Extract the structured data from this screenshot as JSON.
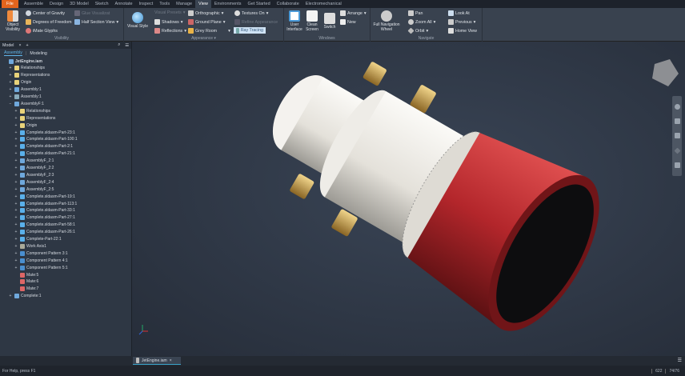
{
  "ribbon_tabs": [
    {
      "label": "File"
    },
    {
      "label": "Assemble"
    },
    {
      "label": "Design"
    },
    {
      "label": "3D Model"
    },
    {
      "label": "Sketch"
    },
    {
      "label": "Annotate"
    },
    {
      "label": "Inspect"
    },
    {
      "label": "Tools"
    },
    {
      "label": "Manage"
    },
    {
      "label": "View"
    },
    {
      "label": "Environments"
    },
    {
      "label": "Get Started"
    },
    {
      "label": "Collaborate"
    },
    {
      "label": "Electromechanical"
    }
  ],
  "active_tab": "View",
  "visibility": {
    "label": "Visibility",
    "object_visibility": "Object Visibility",
    "center_of_gravity": "Center of Gravity",
    "degrees_of_freedom": "Degrees of Freedom",
    "imate_glyphs": "iMate Glyphs",
    "glue_visualization": "Glue Visualizat",
    "half_section_view": "Half Section View"
  },
  "appearance": {
    "label": "Appearance",
    "visual_style": "Visual Style",
    "shadows": "Shadows",
    "reflections": "Reflections",
    "visual_presets": "Visual Presets",
    "orthographic": "Orthographic",
    "ground_plane": "Ground Plane",
    "grey_room": "Grey Room",
    "textures_on": "Textures On",
    "refine_appearance": "Refine Appearance",
    "highlight_value": "Ray Tracing"
  },
  "windows": {
    "label": "Windows",
    "user_interface": "User Interface",
    "clean_screen": "Clean Screen",
    "switch": "Switch",
    "arrange": "Arrange",
    "new": "New"
  },
  "navigate": {
    "label": "Navigate",
    "full_navigation_wheel": "Full Navigation Wheel",
    "pan": "Pan",
    "zoom_all": "Zoom All",
    "orbit": "Orbit",
    "look_at": "Look At",
    "previous": "Previous",
    "home_view": "Home View"
  },
  "browser": {
    "tab": "Model",
    "subtabs": [
      "Assembly",
      "Modeling"
    ],
    "items": [
      {
        "label": "JetEngine.iam",
        "level": 0,
        "icon": "assembly",
        "exp": ""
      },
      {
        "label": "Relationships",
        "level": 1,
        "icon": "folder",
        "exp": "+"
      },
      {
        "label": "Representations",
        "level": 1,
        "icon": "folder",
        "exp": "+"
      },
      {
        "label": "Origin",
        "level": 1,
        "icon": "folder",
        "exp": "+"
      },
      {
        "label": "Assembly:1",
        "level": 1,
        "icon": "assembly",
        "exp": "+"
      },
      {
        "label": "Assembly:1",
        "level": 1,
        "icon": "pattern-assembly",
        "exp": "+"
      },
      {
        "label": "AssemblyF:1",
        "level": 1,
        "icon": "assembly",
        "exp": "−"
      },
      {
        "label": "Relationships",
        "level": 2,
        "icon": "folder",
        "exp": "+"
      },
      {
        "label": "Representations",
        "level": 2,
        "icon": "folder",
        "exp": "+"
      },
      {
        "label": "Origin",
        "level": 2,
        "icon": "folder",
        "exp": "+"
      },
      {
        "label": "Complete.sldasm-Part-23:1",
        "level": 2,
        "icon": "part",
        "exp": "+"
      },
      {
        "label": "Complete.sldasm-Part-100:1",
        "level": 2,
        "icon": "part",
        "exp": "+"
      },
      {
        "label": "Complete.sldasm-Part-2:1",
        "level": 2,
        "icon": "part",
        "exp": "+"
      },
      {
        "label": "Complete.sldasm-Part-21:1",
        "level": 2,
        "icon": "part",
        "exp": "+"
      },
      {
        "label": "AssemblyF_2:1",
        "level": 2,
        "icon": "assembly",
        "exp": "+"
      },
      {
        "label": "AssemblyF_2:2",
        "level": 2,
        "icon": "assembly",
        "exp": "+"
      },
      {
        "label": "AssemblyF_2:3",
        "level": 2,
        "icon": "assembly",
        "exp": "+"
      },
      {
        "label": "AssemblyF_2:4",
        "level": 2,
        "icon": "assembly",
        "exp": "+"
      },
      {
        "label": "AssemblyF_2:5",
        "level": 2,
        "icon": "assembly",
        "exp": "+"
      },
      {
        "label": "Complete.sldasm-Part-19:1",
        "level": 2,
        "icon": "part",
        "exp": "+"
      },
      {
        "label": "Complete.sldasm-Part-113:1",
        "level": 2,
        "icon": "part",
        "exp": "+"
      },
      {
        "label": "Complete.sldasm-Part-33:1",
        "level": 2,
        "icon": "part",
        "exp": "+"
      },
      {
        "label": "Complete.sldasm-Part-27:1",
        "level": 2,
        "icon": "part",
        "exp": "+"
      },
      {
        "label": "Complete.sldasm-Part-58:1",
        "level": 2,
        "icon": "part",
        "exp": "+"
      },
      {
        "label": "Complete.sldasm-Part-26:1",
        "level": 2,
        "icon": "part",
        "exp": "+"
      },
      {
        "label": "Complete-Part-22:1",
        "level": 2,
        "icon": "part",
        "exp": "+"
      },
      {
        "label": "Work Axis1",
        "level": 2,
        "icon": "axis",
        "exp": "+"
      },
      {
        "label": "Component Pattern 3:1",
        "level": 2,
        "icon": "pattern",
        "exp": "+"
      },
      {
        "label": "Component Pattern 4:1",
        "level": 2,
        "icon": "pattern",
        "exp": "+"
      },
      {
        "label": "Component Pattern 5:1",
        "level": 2,
        "icon": "pattern",
        "exp": "+"
      },
      {
        "label": "Mate:5",
        "level": 2,
        "icon": "mate",
        "exp": ""
      },
      {
        "label": "Mate:6",
        "level": 2,
        "icon": "mate",
        "exp": ""
      },
      {
        "label": "Mate:7",
        "level": 2,
        "icon": "mate",
        "exp": ""
      },
      {
        "label": "Complete:1",
        "level": 1,
        "icon": "assembly",
        "exp": "+"
      }
    ]
  },
  "document_tab": "JetEngine.iam",
  "status": {
    "help": "For Help, press F1",
    "count1": "622",
    "count2": "74/76"
  },
  "colors": {
    "file_tab": "#e2641d",
    "accent": "#3aa3c8",
    "nozzle": "#b3262b",
    "brass": "#c9a24a",
    "body": "#e9e7e2"
  }
}
